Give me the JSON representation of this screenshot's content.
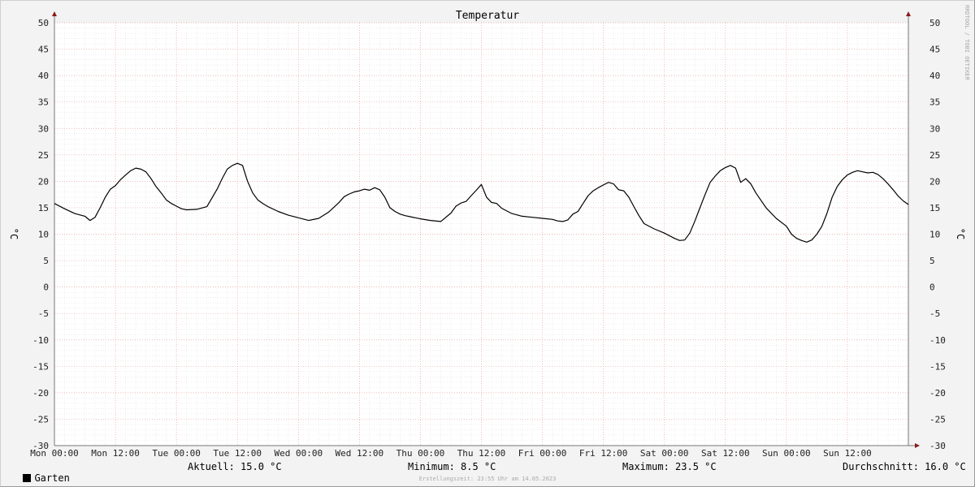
{
  "chart_data": {
    "type": "line",
    "title": "Temperatur",
    "ylabel_left": "°C",
    "ylabel_right": "°C",
    "watermark": "RRDTOOL / TOBI OETIKER",
    "ylim": [
      -30,
      50
    ],
    "yticks": [
      50,
      45,
      40,
      35,
      30,
      25,
      20,
      15,
      10,
      5,
      0,
      -5,
      -10,
      -15,
      -20,
      -25,
      -30
    ],
    "xlim_hours": [
      0,
      168
    ],
    "xticks": [
      {
        "hour": 0,
        "label": "Mon 00:00"
      },
      {
        "hour": 12,
        "label": "Mon 12:00"
      },
      {
        "hour": 24,
        "label": "Tue 00:00"
      },
      {
        "hour": 36,
        "label": "Tue 12:00"
      },
      {
        "hour": 48,
        "label": "Wed 00:00"
      },
      {
        "hour": 60,
        "label": "Wed 12:00"
      },
      {
        "hour": 72,
        "label": "Thu 00:00"
      },
      {
        "hour": 84,
        "label": "Thu 12:00"
      },
      {
        "hour": 96,
        "label": "Fri 00:00"
      },
      {
        "hour": 108,
        "label": "Fri 12:00"
      },
      {
        "hour": 120,
        "label": "Sat 00:00"
      },
      {
        "hour": 132,
        "label": "Sat 12:00"
      },
      {
        "hour": 144,
        "label": "Sun 00:00"
      },
      {
        "hour": 156,
        "label": "Sun 12:00"
      }
    ],
    "grid": true,
    "series": [
      {
        "name": "Garten",
        "color": "#000000",
        "x_hours": [
          0,
          2,
          4,
          6,
          7,
          8,
          9,
          10,
          11,
          12,
          13,
          14,
          15,
          16,
          17,
          18,
          19,
          20,
          21,
          22,
          23,
          24,
          25,
          26,
          28,
          30,
          32,
          33,
          34,
          35,
          36,
          37,
          38,
          39,
          40,
          41,
          42,
          44,
          46,
          48,
          50,
          52,
          54,
          56,
          57,
          58,
          59,
          60,
          61,
          62,
          63,
          64,
          65,
          66,
          67,
          68,
          69,
          70,
          71,
          72,
          74,
          76,
          78,
          79,
          80,
          81,
          82,
          83,
          84,
          85,
          86,
          87,
          88,
          90,
          92,
          94,
          96,
          98,
          99,
          100,
          101,
          102,
          103,
          104,
          105,
          106,
          107,
          108,
          109,
          110,
          111,
          112,
          113,
          114,
          115,
          116,
          118,
          120,
          122,
          123,
          124,
          125,
          126,
          127,
          128,
          129,
          130,
          131,
          132,
          133,
          134,
          135,
          136,
          137,
          138,
          140,
          142,
          144,
          145,
          146,
          147,
          148,
          149,
          150,
          151,
          152,
          153,
          154,
          155,
          156,
          157,
          158,
          159,
          160,
          161,
          162,
          163,
          164,
          165,
          166,
          167,
          168
        ],
        "y": [
          15.8,
          14.8,
          13.9,
          13.4,
          12.6,
          13.2,
          15.0,
          17.0,
          18.5,
          19.2,
          20.3,
          21.2,
          22.0,
          22.5,
          22.3,
          21.8,
          20.5,
          19.0,
          17.8,
          16.5,
          15.8,
          15.3,
          14.8,
          14.6,
          14.7,
          15.2,
          18.5,
          20.5,
          22.3,
          23.0,
          23.4,
          23.0,
          20.0,
          17.8,
          16.5,
          15.8,
          15.2,
          14.3,
          13.6,
          13.1,
          12.6,
          13.0,
          14.2,
          16.0,
          17.1,
          17.6,
          18.0,
          18.2,
          18.5,
          18.3,
          18.8,
          18.4,
          17.0,
          15.0,
          14.3,
          13.8,
          13.5,
          13.3,
          13.1,
          12.9,
          12.6,
          12.4,
          14.0,
          15.3,
          15.9,
          16.2,
          17.3,
          18.3,
          19.4,
          17.0,
          16.0,
          15.8,
          14.9,
          13.9,
          13.4,
          13.2,
          13.0,
          12.8,
          12.5,
          12.4,
          12.7,
          13.8,
          14.3,
          15.8,
          17.3,
          18.2,
          18.8,
          19.3,
          19.8,
          19.5,
          18.4,
          18.2,
          17.0,
          15.2,
          13.5,
          12.0,
          11.0,
          10.2,
          9.2,
          8.8,
          8.9,
          10.2,
          12.5,
          15.0,
          17.5,
          19.8,
          21.0,
          22.0,
          22.6,
          23.0,
          22.5,
          19.8,
          20.5,
          19.5,
          17.8,
          15.0,
          13.0,
          11.5,
          10.0,
          9.2,
          8.8,
          8.5,
          8.9,
          10.0,
          11.5,
          14.0,
          17.0,
          19.0,
          20.3,
          21.2,
          21.7,
          22.0,
          21.8,
          21.6,
          21.7,
          21.3,
          20.5,
          19.5,
          18.4,
          17.2,
          16.3,
          15.6,
          15.0
        ]
      }
    ],
    "legend": {
      "series_label": "Garten",
      "current": "Aktuell: 15.0 °C",
      "minimum": "Minimum: 8.5 °C",
      "maximum": "Maximum: 23.5 °C",
      "average": "Durchschnitt: 16.0 °C"
    },
    "footer": "Erstellungszeit: 23:55 Uhr am 14.05.2023"
  }
}
